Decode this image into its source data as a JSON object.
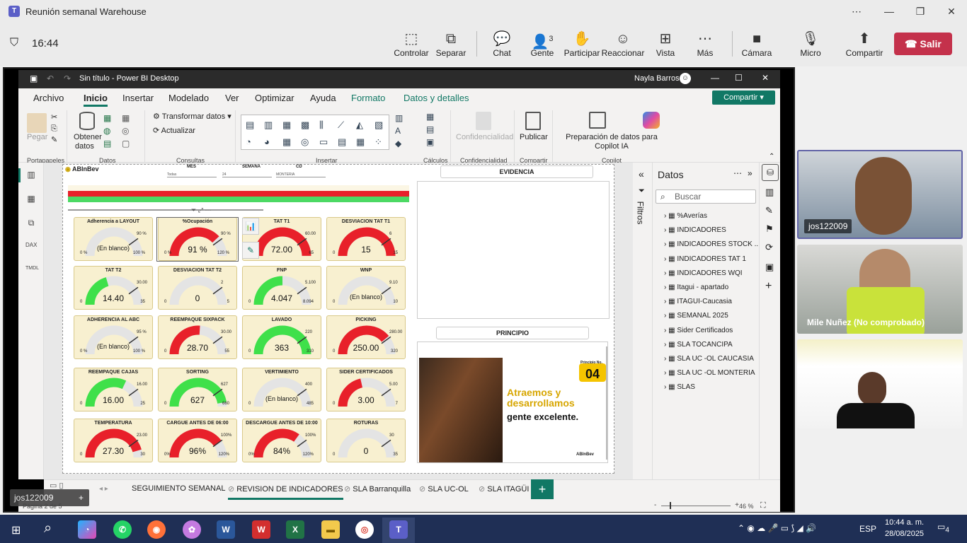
{
  "teams": {
    "title": "Reunión semanal Warehouse",
    "time": "16:44",
    "tools": [
      {
        "label": "Controlar",
        "icon": "control-icon"
      },
      {
        "label": "Separar",
        "icon": "popout-icon"
      },
      {
        "label": "Chat",
        "icon": "chat-icon"
      },
      {
        "label": "Gente",
        "icon": "people-icon",
        "count": "3"
      },
      {
        "label": "Participar",
        "icon": "raise-hand-icon"
      },
      {
        "label": "Reaccionar",
        "icon": "smile-icon"
      },
      {
        "label": "Vista",
        "icon": "grid-icon"
      },
      {
        "label": "Más",
        "icon": "more-icon"
      },
      {
        "label": "Cámara",
        "icon": "camera-icon"
      },
      {
        "label": "Micro",
        "icon": "mic-icon"
      },
      {
        "label": "Compartir",
        "icon": "share-icon"
      }
    ],
    "leave_label": "Salir"
  },
  "powerbi": {
    "title": "Sin título - Power BI Desktop",
    "user": "Nayla Barros",
    "ribbon_tabs": [
      "Archivo",
      "Inicio",
      "Insertar",
      "Modelado",
      "Ver",
      "Optimizar",
      "Ayuda",
      "Formato",
      "Datos y detalles"
    ],
    "share_label": "Compartir",
    "ribbon": {
      "pegar": "Pegar",
      "portapapeles": "Portapapeles",
      "obtener": "Obtener",
      "datos_btn": "datos",
      "datos_group": "Datos",
      "transformar": "Transformar datos",
      "actualizar": "Actualizar",
      "consultas": "Consultas",
      "insertar_group": "Insertar",
      "calculos": "Cálculos",
      "confidencialidad_btn": "Confidencialidad",
      "confidencialidad_group": "Confidencialidad",
      "publicar": "Publicar",
      "compartir_group": "Compartir",
      "copilot_btn": "Preparación de datos para Copilot IA",
      "copilot_group": "Copilot"
    },
    "report": {
      "logo": "ABInBev",
      "filters": [
        {
          "label": "MES",
          "value": "Todas"
        },
        {
          "label": "SEMANA",
          "value": "24"
        },
        {
          "label": "CD",
          "value": "MONTERIA"
        }
      ],
      "evidencia": "EVIDENCIA",
      "principio": "PRINCIPIO",
      "principio_no": "04",
      "principio_label": "Principio No.",
      "principio_text1": "Atraemos y desarrollamos",
      "principio_text2": "gente excelente.",
      "principio_brand": "ABInBev",
      "gauges": [
        {
          "title": "Adherencia a LAYOUT",
          "value": "(En blanco)",
          "min": "0 %",
          "max": "100 %",
          "target": "90 %",
          "fill": 0,
          "color": "#e0e0e0"
        },
        {
          "title": "%Ocupación",
          "value": "91 %",
          "min": "0 %",
          "max": "120 %",
          "target": "90 %",
          "fill": 0.76,
          "color": "#e8202a"
        },
        {
          "title": "TAT T1",
          "value": "72.00",
          "min": "0",
          "max": "65",
          "target": "60.00",
          "fill": 1,
          "color": "#e8202a"
        },
        {
          "title": "DESVIACION TAT T1",
          "value": "15",
          "min": "0",
          "max": "15",
          "target": "6",
          "fill": 1,
          "color": "#e8202a"
        },
        {
          "title": "TAT T2",
          "value": "14.40",
          "min": "0",
          "max": "35",
          "target": "30.00",
          "fill": 0.41,
          "color": "#3fe04a"
        },
        {
          "title": "DESVIACION TAT T2",
          "value": "0",
          "min": "0",
          "max": "5",
          "target": "2",
          "fill": 0,
          "color": "#e0e0e0"
        },
        {
          "title": "FNP",
          "value": "4.047",
          "min": "0",
          "max": "8.094",
          "target": "5.100",
          "fill": 0.5,
          "color": "#3fe04a"
        },
        {
          "title": "WNP",
          "value": "(En blanco)",
          "min": "0",
          "max": "10",
          "target": "9.10",
          "fill": 0,
          "color": "#e0e0e0"
        },
        {
          "title": "ADHERENCIA AL ABC",
          "value": "(En blanco)",
          "min": "0 %",
          "max": "100 %",
          "target": "95 %",
          "fill": 0,
          "color": "#e0e0e0"
        },
        {
          "title": "REEMPAQUE SIXPACK",
          "value": "28.70",
          "min": "0",
          "max": "55",
          "target": "30.00",
          "fill": 0.52,
          "color": "#e8202a"
        },
        {
          "title": "LAVADO",
          "value": "363",
          "min": "0",
          "max": "310",
          "target": "220",
          "fill": 1,
          "color": "#3fe04a"
        },
        {
          "title": "PICKING",
          "value": "250.00",
          "min": "0",
          "max": "320",
          "target": "280.00",
          "fill": 0.78,
          "color": "#e8202a"
        },
        {
          "title": "REEMPAQUE CAJAS",
          "value": "16.00",
          "min": "0",
          "max": "25",
          "target": "16.00",
          "fill": 0.64,
          "color": "#3fe04a"
        },
        {
          "title": "SORTING",
          "value": "627",
          "min": "0",
          "max": "660",
          "target": "627",
          "fill": 0.95,
          "color": "#3fe04a"
        },
        {
          "title": "VERTIMIENTO",
          "value": "(En blanco)",
          "min": "0",
          "max": "485",
          "target": "400",
          "fill": 0,
          "color": "#e0e0e0"
        },
        {
          "title": "SIDER CERTIFICADOS",
          "value": "3.00",
          "min": "0",
          "max": "7",
          "target": "5.00",
          "fill": 0.43,
          "color": "#e8202a"
        },
        {
          "title": "TEMPERATURA",
          "value": "27.30",
          "min": "0",
          "max": "30",
          "target": "23.00",
          "fill": 0.91,
          "color": "#e8202a"
        },
        {
          "title": "CARGUE ANTES DE 06:00",
          "value": "96%",
          "min": "0%",
          "max": "120%",
          "target": "100%",
          "fill": 0.8,
          "color": "#e8202a"
        },
        {
          "title": "DESCARGUE ANTES DE 10:00",
          "value": "84%",
          "min": "0%",
          "max": "120%",
          "target": "100%",
          "fill": 0.7,
          "color": "#e8202a"
        },
        {
          "title": "ROTURAS",
          "value": "0",
          "min": "0",
          "max": "35",
          "target": "30",
          "fill": 0,
          "color": "#e0e0e0"
        }
      ]
    },
    "datos_title": "Datos",
    "filtros_label": "Filtros",
    "search_placeholder": "Buscar",
    "tables": [
      "%Averías",
      "INDICADORES",
      "INDICADORES STOCK ...",
      "INDICADORES TAT 1",
      "INDICADORES WQI",
      "Itagui - apartado",
      "ITAGUI-Caucasia",
      "SEMANAL 2025",
      "Sider Certificados",
      "SLA TOCANCIPA",
      "SLA UC -OL CAUCASIA",
      "SLA UC -OL MONTERIA",
      "SLAS"
    ],
    "pages": [
      "SEGUIMIENTO SEMANAL",
      "REVISION DE INDICADORES",
      "SLA Barranquilla",
      "SLA UC-OL",
      "SLA ITAGÜI"
    ],
    "page_status": "Página 2 de 5",
    "zoom": "46 %"
  },
  "participants": [
    {
      "name": "jos122009"
    },
    {
      "name": "Mile Nuñez (No comprobado)"
    },
    {
      "name": ""
    }
  ],
  "self_label": "jos122009",
  "taskbar": {
    "lang": "ESP",
    "time": "10:44 a. m.",
    "date": "28/08/2025",
    "notifications": "4"
  }
}
